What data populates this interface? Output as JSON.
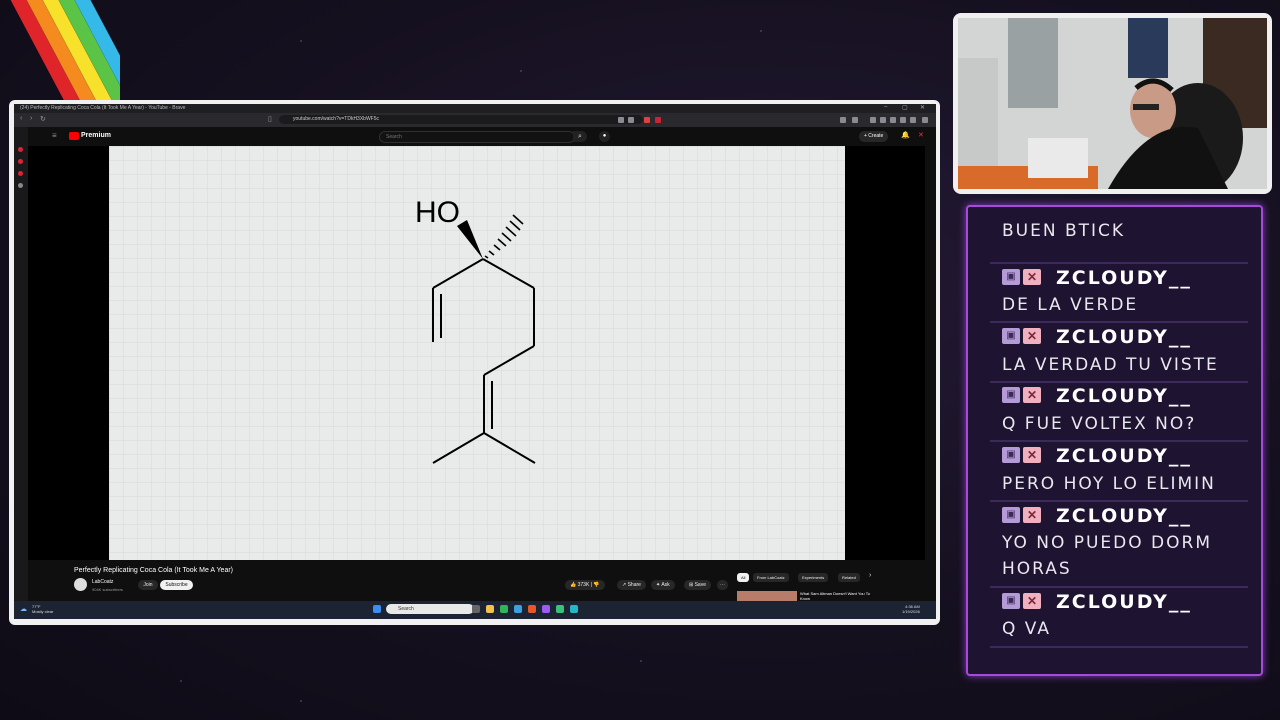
{
  "browser": {
    "window_title": "(24) Perfectly Replicating Coca Cola (It Took Me A Year) - YouTube - Brave",
    "url": "youtube.com/watch?v=TDkH3XbWF5c"
  },
  "youtube": {
    "logo_label": "Premium",
    "search_placeholder": "Search",
    "create_label": "+ Create",
    "video_title": "Perfectly Replicating Coca Cola (It Took Me A Year)",
    "channel_name": "LabCoatz",
    "channel_subs": "904K subscribers",
    "join_label": "Join",
    "subscribe_label": "Subscribe",
    "likes": "373K",
    "share_label": "Share",
    "ask_label": "Ask",
    "save_label": "Save",
    "chips": [
      "All",
      "From LabCoatz",
      "Experiments",
      "Related"
    ],
    "suggested_title": "What Sam Altman Doesn't Want You To Know"
  },
  "molecule": {
    "label": "HO"
  },
  "taskbar": {
    "weather": "77°F",
    "weather_sub": "Mostly clear",
    "search_placeholder": "Search",
    "time": "4:36 AM",
    "date": "1/19/2026"
  },
  "chat": {
    "messages": [
      {
        "user": "",
        "text": "BUEN BTICK"
      },
      {
        "user": "ZCLOUDY__",
        "text": "DE LA VERDE"
      },
      {
        "user": "ZCLOUDY__",
        "text": "LA VERDAD TU VISTE"
      },
      {
        "user": "ZCLOUDY__",
        "text": "Q FUE VOLTEX NO?"
      },
      {
        "user": "ZCLOUDY__",
        "text": "PERO HOY LO ELIMIN"
      },
      {
        "user": "ZCLOUDY__",
        "text": "YO NO PUEDO DORM",
        "text2": "HORAS"
      },
      {
        "user": "ZCLOUDY__",
        "text": "Q VA"
      }
    ]
  },
  "colors": {
    "chat_border": "#a64bd8",
    "yt_red": "#ff0000"
  }
}
